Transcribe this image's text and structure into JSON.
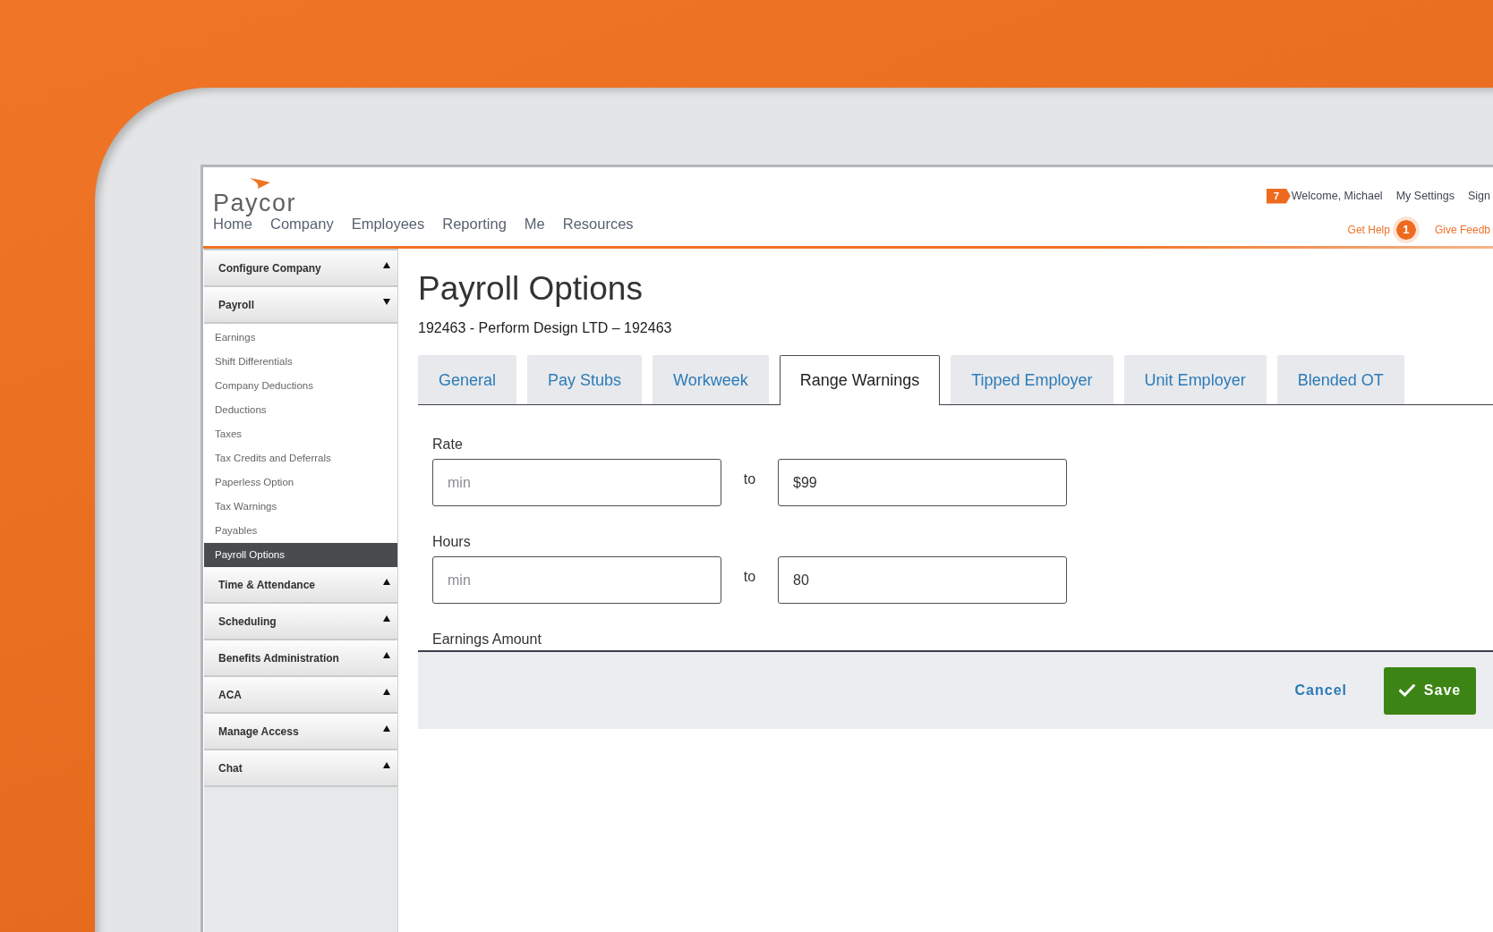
{
  "header": {
    "logo": "Paycor",
    "nav": [
      "Home",
      "Company",
      "Employees",
      "Reporting",
      "Me",
      "Resources"
    ],
    "account": {
      "notification_count": "7",
      "welcome": "Welcome, Michael",
      "links": [
        "My Settings",
        "Sign"
      ]
    },
    "help": {
      "label": "Get Help",
      "count": "1",
      "feedback": "Give Feedb"
    }
  },
  "sidebar": {
    "sections": [
      {
        "label": "Configure Company",
        "expanded": false
      },
      {
        "label": "Payroll",
        "expanded": true,
        "children": [
          {
            "label": "Earnings",
            "selected": false
          },
          {
            "label": "Shift Differentials",
            "selected": false
          },
          {
            "label": "Company Deductions",
            "selected": false
          },
          {
            "label": "Deductions",
            "selected": false
          },
          {
            "label": "Taxes",
            "selected": false
          },
          {
            "label": "Tax Credits and Deferrals",
            "selected": false
          },
          {
            "label": "Paperless Option",
            "selected": false
          },
          {
            "label": "Tax Warnings",
            "selected": false
          },
          {
            "label": "Payables",
            "selected": false
          },
          {
            "label": "Payroll Options",
            "selected": true
          }
        ]
      },
      {
        "label": "Time & Attendance",
        "expanded": false
      },
      {
        "label": "Scheduling",
        "expanded": false
      },
      {
        "label": "Benefits Administration",
        "expanded": false
      },
      {
        "label": "ACA",
        "expanded": false
      },
      {
        "label": "Manage Access",
        "expanded": false
      },
      {
        "label": "Chat",
        "expanded": false
      }
    ]
  },
  "page": {
    "title": "Payroll Options",
    "subtitle": "192463 - Perform Design LTD – 192463"
  },
  "tabs": [
    {
      "label": "General",
      "selected": false
    },
    {
      "label": "Pay Stubs",
      "selected": false
    },
    {
      "label": "Workweek",
      "selected": false
    },
    {
      "label": "Range Warnings",
      "selected": true
    },
    {
      "label": "Tipped Employer",
      "selected": false
    },
    {
      "label": "Unit Employer",
      "selected": false
    },
    {
      "label": "Blended OT",
      "selected": false
    }
  ],
  "form": {
    "fields": [
      {
        "label": "Rate",
        "min": {
          "placeholder": "min"
        },
        "separator": "to",
        "max": {
          "value": "$99"
        }
      },
      {
        "label": "Hours",
        "min": {
          "placeholder": "min"
        },
        "separator": "to",
        "max": {
          "value": "80"
        }
      },
      {
        "label": "Earnings Amount"
      }
    ]
  },
  "footer": {
    "cancel": "Cancel",
    "save": "Save"
  }
}
